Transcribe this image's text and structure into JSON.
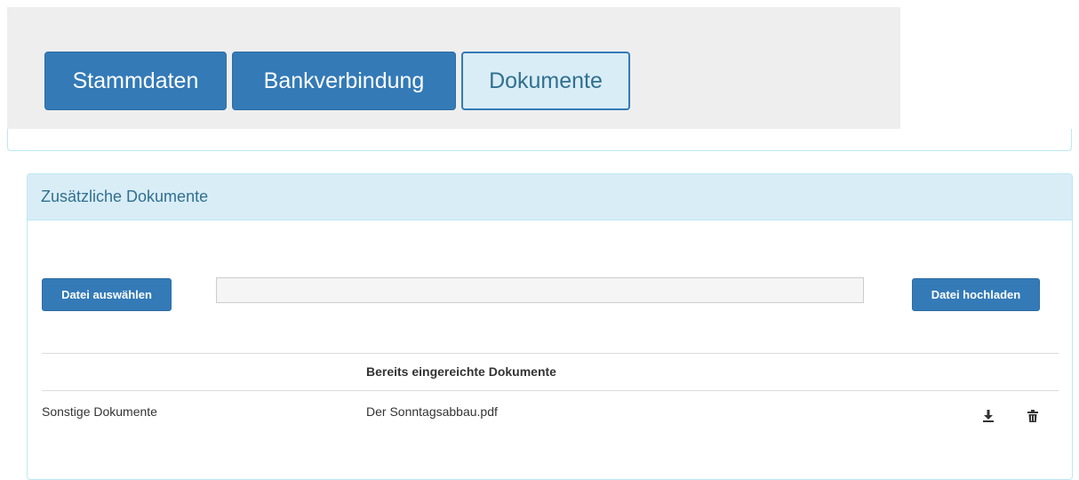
{
  "tabs": [
    {
      "label": "Stammdaten",
      "state": "default"
    },
    {
      "label": "Bankverbindung",
      "state": "default"
    },
    {
      "label": "Dokumente",
      "state": "active"
    }
  ],
  "panel": {
    "title": "Zusätzliche Dokumente",
    "choose_file_label": "Datei auswählen",
    "upload_label": "Datei hochladen",
    "file_input_value": ""
  },
  "table": {
    "headers": [
      "",
      "Bereits eingereichte Dokumente",
      ""
    ],
    "rows": [
      {
        "type": "Sonstige Dokumente",
        "file": "Der Sonntagsabbau.pdf",
        "actions": [
          "download-icon",
          "trash-icon"
        ]
      }
    ]
  },
  "colors": {
    "primary": "#337ab7",
    "info_bg": "#d9edf7",
    "info_text": "#31708f",
    "info_border": "#bce8f1"
  }
}
